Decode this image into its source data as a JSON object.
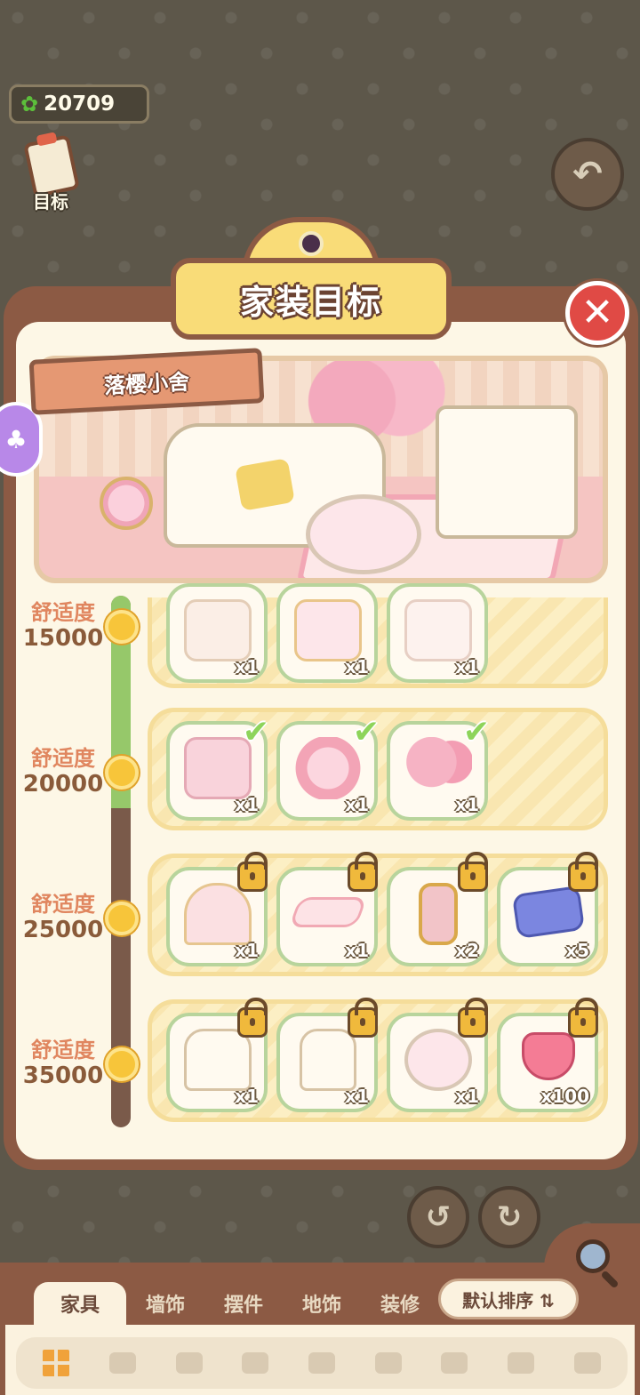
{
  "hud": {
    "currency_amount": "20709",
    "goal_label": "目标"
  },
  "dialog": {
    "title": "家装目标",
    "room_name": "落樱小舍",
    "progress_fraction": 0.4
  },
  "tiers": [
    {
      "name": "舒适度",
      "value": "15000",
      "items": [
        {
          "icon": "cabinet",
          "qty": "x1",
          "status": "done"
        },
        {
          "icon": "sakura-screen",
          "qty": "x1",
          "status": "done"
        },
        {
          "icon": "branch-vase",
          "qty": "x1",
          "status": "done"
        }
      ]
    },
    {
      "name": "舒适度",
      "value": "20000",
      "items": [
        {
          "icon": "sakura-dresser",
          "qty": "x1",
          "status": "done"
        },
        {
          "icon": "sakura-lamp",
          "qty": "x1",
          "status": "done"
        },
        {
          "icon": "sakura-tree",
          "qty": "x1",
          "status": "done"
        }
      ]
    },
    {
      "name": "舒适度",
      "value": "25000",
      "items": [
        {
          "icon": "sakura-window",
          "qty": "x1",
          "status": "locked"
        },
        {
          "icon": "sakura-rug",
          "qty": "x1",
          "status": "locked"
        },
        {
          "icon": "sakura-painting",
          "qty": "x2",
          "status": "locked"
        },
        {
          "icon": "bunny-ticket",
          "qty": "x5",
          "status": "locked"
        }
      ]
    },
    {
      "name": "舒适度",
      "value": "35000",
      "items": [
        {
          "icon": "sakura-sofa",
          "qty": "x1",
          "status": "locked"
        },
        {
          "icon": "sakura-armchair",
          "qty": "x1",
          "status": "locked"
        },
        {
          "icon": "sakura-table",
          "qty": "x1",
          "status": "locked"
        },
        {
          "icon": "heart-gem",
          "qty": "x100",
          "status": "locked"
        }
      ]
    }
  ],
  "tabs": [
    "家具",
    "墙饰",
    "摆件",
    "地饰",
    "装修"
  ],
  "sort_label": "默认排序 ⇅",
  "colors": {
    "accent": "#f9dc78",
    "frame": "#8c5a44",
    "panel": "#fdf7e6",
    "close": "#e04a45"
  }
}
